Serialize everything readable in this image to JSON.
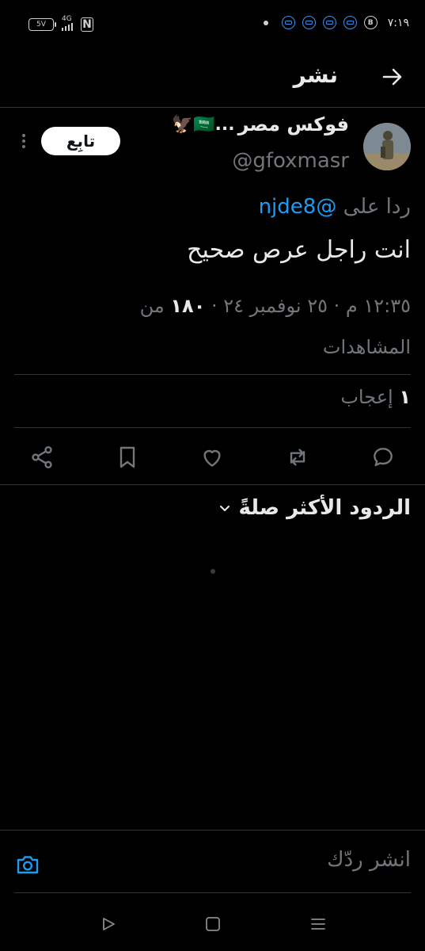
{
  "status_bar": {
    "battery": "5V",
    "network": "4G",
    "time": "٧:١٩",
    "b_badge": "B"
  },
  "header": {
    "title": "نشر"
  },
  "tweet": {
    "name": "فوكس مصر",
    "name_suffix": "🦅🇸🇦...",
    "handle": "@gfoxmasr",
    "follow_label": "تابِع",
    "reply_prefix": "ردا على",
    "reply_mention": "@njde8",
    "text": "انت راجل عرص صحيح",
    "meta_time": "١٢:٣٥ م · ٢٥ نوفمبر ٢٤ · ",
    "views_count": "١٨٠",
    "views_label": " من المشاهدات",
    "likes_count": "١",
    "likes_label": " إعجاب"
  },
  "replies": {
    "sort_label": "الردود الأكثر صلةً"
  },
  "composer": {
    "placeholder": "انشر ردّك"
  },
  "colors": {
    "background": "#000000",
    "accent": "#1d9bf0",
    "muted": "#71767b",
    "divider": "#2f3336"
  }
}
